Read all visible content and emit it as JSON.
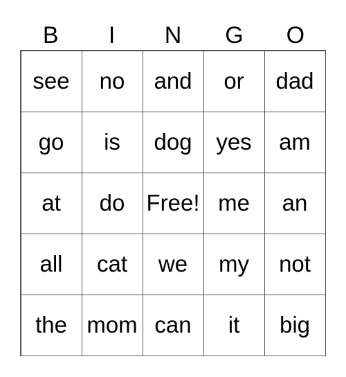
{
  "header": [
    "B",
    "I",
    "N",
    "G",
    "O"
  ],
  "rows": [
    [
      "see",
      "no",
      "and",
      "or",
      "dad"
    ],
    [
      "go",
      "is",
      "dog",
      "yes",
      "am"
    ],
    [
      "at",
      "do",
      "Free!",
      "me",
      "an"
    ],
    [
      "all",
      "cat",
      "we",
      "my",
      "not"
    ],
    [
      "the",
      "mom",
      "can",
      "it",
      "big"
    ]
  ]
}
